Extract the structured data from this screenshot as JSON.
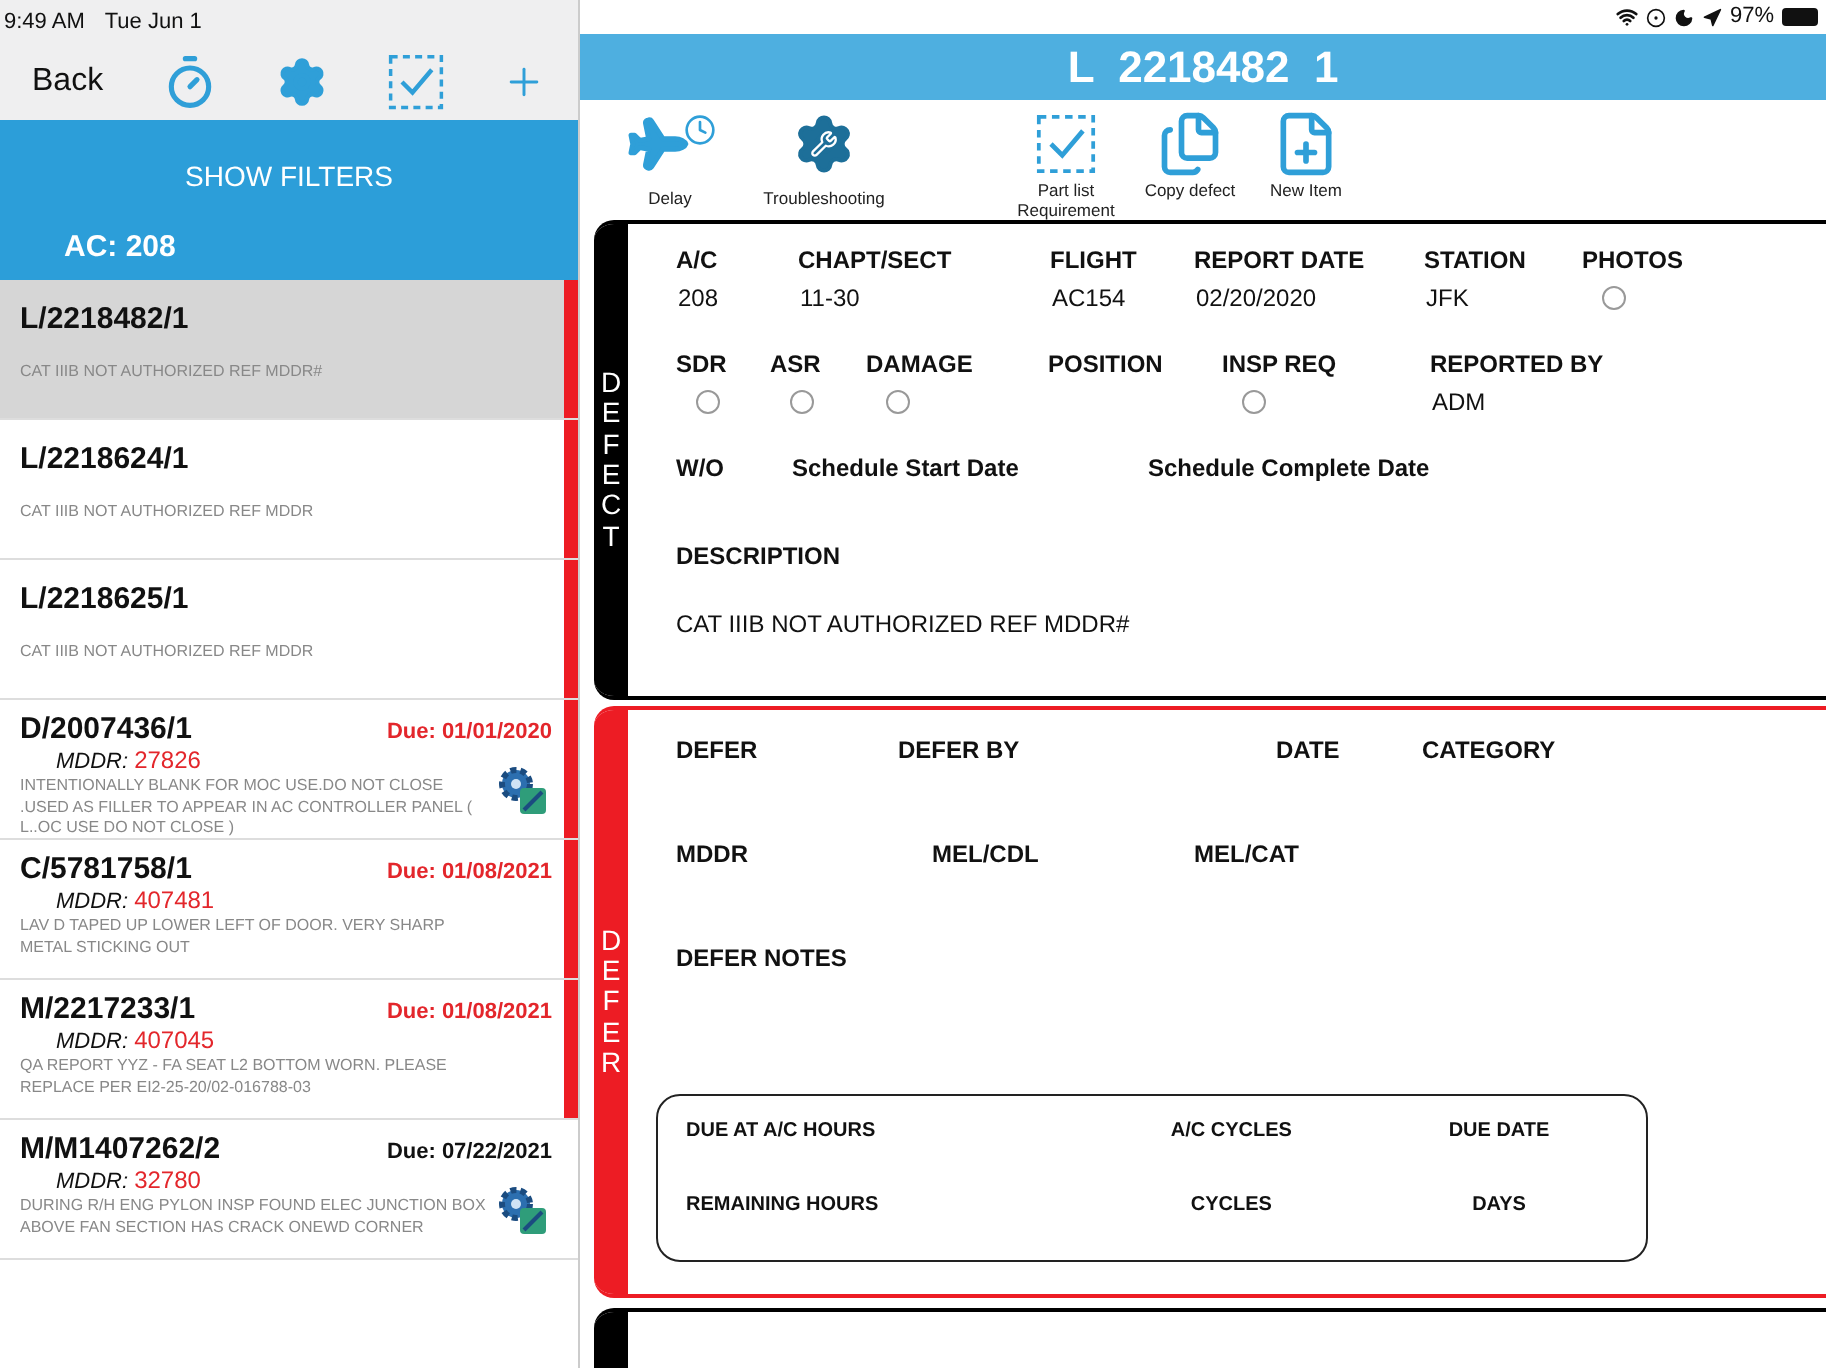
{
  "status_bar": {
    "time": "9:49 AM",
    "date": "Tue Jun 1",
    "battery": "97%"
  },
  "nav": {
    "back": "Back"
  },
  "filters": {
    "button": "SHOW FILTERS",
    "aircraft": "AC: 208"
  },
  "defects": [
    {
      "kind": "simple",
      "id": "L/2218482/1",
      "description": "CAT IIIB NOT AUTHORIZED REF MDDR#",
      "selected": true,
      "flagged": true
    },
    {
      "kind": "simple",
      "id": "L/2218624/1",
      "description": "CAT IIIB NOT AUTHORIZED REF MDDR",
      "selected": false,
      "flagged": true
    },
    {
      "kind": "simple",
      "id": "L/2218625/1",
      "description": "CAT IIIB NOT AUTHORIZED REF MDDR",
      "selected": false,
      "flagged": true
    },
    {
      "kind": "due",
      "id": "D/2007436/1",
      "due": "Due: 01/01/2020",
      "mddr_label": "MDDR:",
      "mddr": "27826",
      "description": "INTENTIONALLY BLANK FOR MOC USE.DO NOT CLOSE .USED AS FILLER TO APPEAR IN AC CONTROLLER PANEL  ( L..OC USE DO NOT CLOSE  )",
      "selected": false,
      "flagged": true,
      "troubleshooting": true
    },
    {
      "kind": "due",
      "id": "C/5781758/1",
      "due": "Due: 01/08/2021",
      "mddr_label": "MDDR:",
      "mddr": "407481",
      "description": "LAV D TAPED UP LOWER LEFT OF DOOR. VERY SHARP METAL STICKING OUT",
      "selected": false,
      "flagged": true,
      "troubleshooting": false
    },
    {
      "kind": "due",
      "id": "M/2217233/1",
      "due": "Due: 01/08/2021",
      "mddr_label": "MDDR:",
      "mddr": "407045",
      "description": "QA REPORT YYZ - FA SEAT L2 BOTTOM WORN. PLEASE REPLACE PER EI2-25-20/02-016788-03",
      "selected": false,
      "flagged": true,
      "troubleshooting": false
    },
    {
      "kind": "due",
      "id": "M/M1407262/2",
      "due": "Due: 07/22/2021",
      "mddr_label": "MDDR:",
      "mddr": "32780",
      "description": "DURING R/H ENG PYLON INSP FOUND ELEC JUNCTION BOX ABOVE FAN SECTION HAS CRACK ONEWD CORNER",
      "selected": false,
      "flagged": false,
      "troubleshooting": true
    }
  ],
  "header": {
    "title": "L  2218482  1"
  },
  "toolbar": [
    {
      "kind": "delay",
      "label": "Delay"
    },
    {
      "kind": "troubleshooting",
      "label": "Troubleshooting"
    },
    {
      "kind": "partlist",
      "label": "Part list Requirement"
    },
    {
      "kind": "copy",
      "label": "Copy defect"
    },
    {
      "kind": "new",
      "label": "New Item"
    }
  ],
  "sections": [
    {
      "tab": "DEFECT",
      "color": "#000000",
      "lines": [
        {
          "fields": [
            {
              "label": "A/C",
              "value": "208"
            },
            {
              "label": "CHAPT/SECT",
              "value": "11-30"
            },
            {
              "label": "FLIGHT",
              "value": "AC154"
            },
            {
              "label": "REPORT DATE",
              "value": "02/20/2020"
            },
            {
              "label": "STATION",
              "value": "JFK"
            },
            {
              "label": "PHOTOS",
              "kind": "radio",
              "checked": false
            }
          ]
        },
        {
          "fields": [
            {
              "label": "SDR",
              "kind": "radio",
              "checked": false
            },
            {
              "label": "ASR",
              "kind": "radio",
              "checked": false
            },
            {
              "label": "DAMAGE",
              "kind": "radio",
              "checked": false
            },
            {
              "label": "POSITION"
            },
            {
              "label": "INSP REQ",
              "kind": "radio",
              "checked": false
            },
            {
              "label": "REPORTED BY",
              "value": "ADM"
            }
          ]
        },
        {
          "fields": [
            {
              "label": "W/O"
            },
            {
              "label": "Schedule Start Date"
            },
            {
              "label": "Schedule Complete Date"
            }
          ]
        },
        {
          "fields": [
            {
              "label": "DESCRIPTION",
              "value": "CAT IIIB NOT AUTHORIZED REF MDDR#"
            }
          ]
        }
      ]
    },
    {
      "tab": "DEFER",
      "color": "#ed1c24",
      "lines": [
        {
          "fields": [
            {
              "label": "DEFER"
            },
            {
              "label": "DEFER BY"
            },
            {
              "label": "DATE"
            },
            {
              "label": "CATEGORY"
            }
          ]
        },
        {
          "fields": [
            {
              "label": "MDDR"
            },
            {
              "label": "MEL/CDL"
            },
            {
              "label": "MEL/CAT"
            }
          ]
        },
        {
          "fields": [
            {
              "label": "DEFER NOTES"
            }
          ]
        }
      ],
      "due_box": [
        [
          "DUE AT A/C HOURS",
          "A/C CYCLES",
          "DUE DATE"
        ],
        [
          "REMAINING HOURS",
          "CYCLES",
          "DAYS"
        ]
      ]
    },
    {
      "color": "#000000"
    }
  ]
}
